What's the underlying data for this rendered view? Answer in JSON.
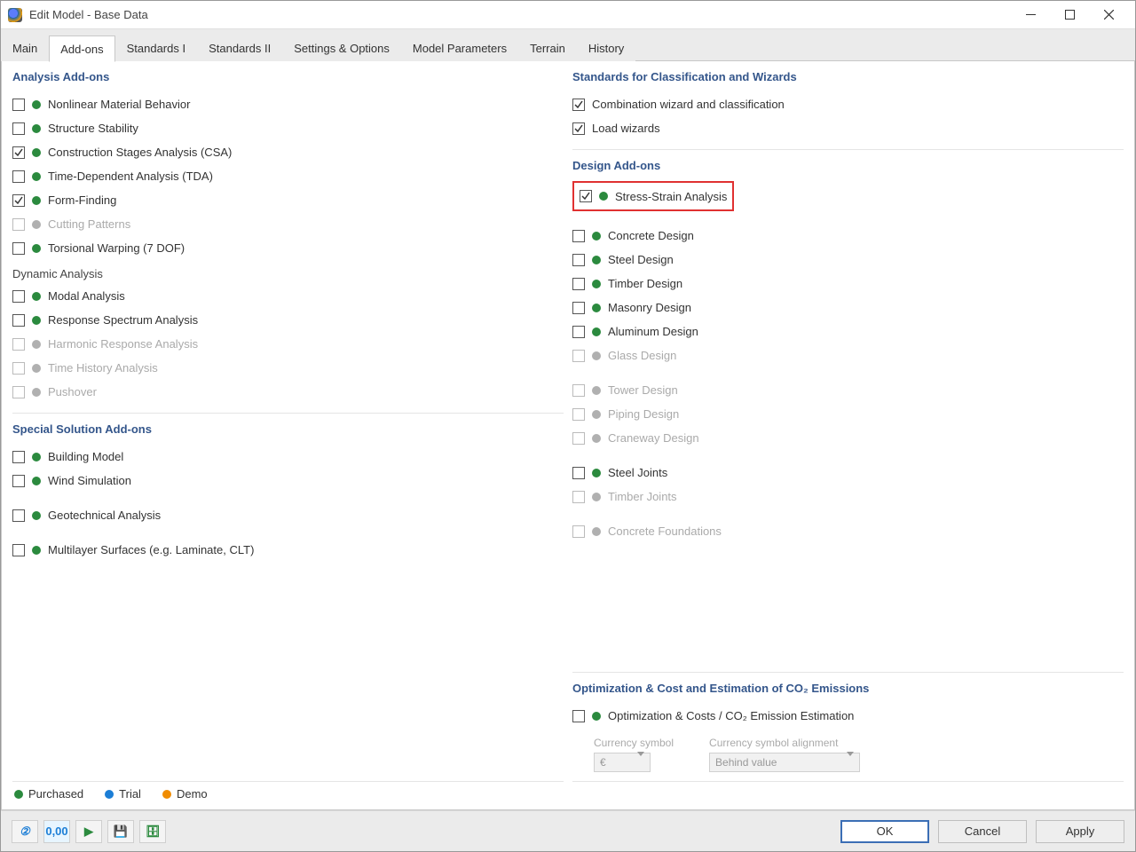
{
  "window": {
    "title": "Edit Model - Base Data"
  },
  "tabs": {
    "main": "Main",
    "addons": "Add-ons",
    "std1": "Standards I",
    "std2": "Standards II",
    "settings": "Settings & Options",
    "params": "Model Parameters",
    "terrain": "Terrain",
    "history": "History"
  },
  "sections": {
    "analysis": "Analysis Add-ons",
    "dynamic": "Dynamic Analysis",
    "special": "Special Solution Add-ons",
    "standards_wiz": "Standards for Classification and Wizards",
    "design": "Design Add-ons",
    "optimization": "Optimization & Cost and Estimation of CO₂ Emissions"
  },
  "analysis": {
    "nonlinear": "Nonlinear Material Behavior",
    "stability": "Structure Stability",
    "csa": "Construction Stages Analysis (CSA)",
    "tda": "Time-Dependent Analysis (TDA)",
    "formfinding": "Form-Finding",
    "cutting": "Cutting Patterns",
    "torsional": "Torsional Warping (7 DOF)"
  },
  "dynamic": {
    "modal": "Modal Analysis",
    "response": "Response Spectrum Analysis",
    "harmonic": "Harmonic Response Analysis",
    "timehistory": "Time History Analysis",
    "pushover": "Pushover"
  },
  "special": {
    "building": "Building Model",
    "wind": "Wind Simulation",
    "geo": "Geotechnical Analysis",
    "multilayer": "Multilayer Surfaces (e.g. Laminate, CLT)"
  },
  "wizards": {
    "combo": "Combination wizard and classification",
    "load": "Load wizards"
  },
  "design": {
    "stress": "Stress-Strain Analysis",
    "concrete": "Concrete Design",
    "steel": "Steel Design",
    "timber": "Timber Design",
    "masonry": "Masonry Design",
    "aluminum": "Aluminum Design",
    "glass": "Glass Design",
    "tower": "Tower Design",
    "piping": "Piping Design",
    "craneway": "Craneway Design",
    "steeljoints": "Steel Joints",
    "timberjoints": "Timber Joints",
    "foundations": "Concrete Foundations"
  },
  "opt": {
    "label": "Optimization & Costs / CO₂ Emission Estimation",
    "currency_label": "Currency symbol",
    "currency_value": "€",
    "alignment_label": "Currency symbol alignment",
    "alignment_value": "Behind value"
  },
  "legend": {
    "purchased": "Purchased",
    "trial": "Trial",
    "demo": "Demo"
  },
  "buttons": {
    "ok": "OK",
    "cancel": "Cancel",
    "apply": "Apply"
  }
}
